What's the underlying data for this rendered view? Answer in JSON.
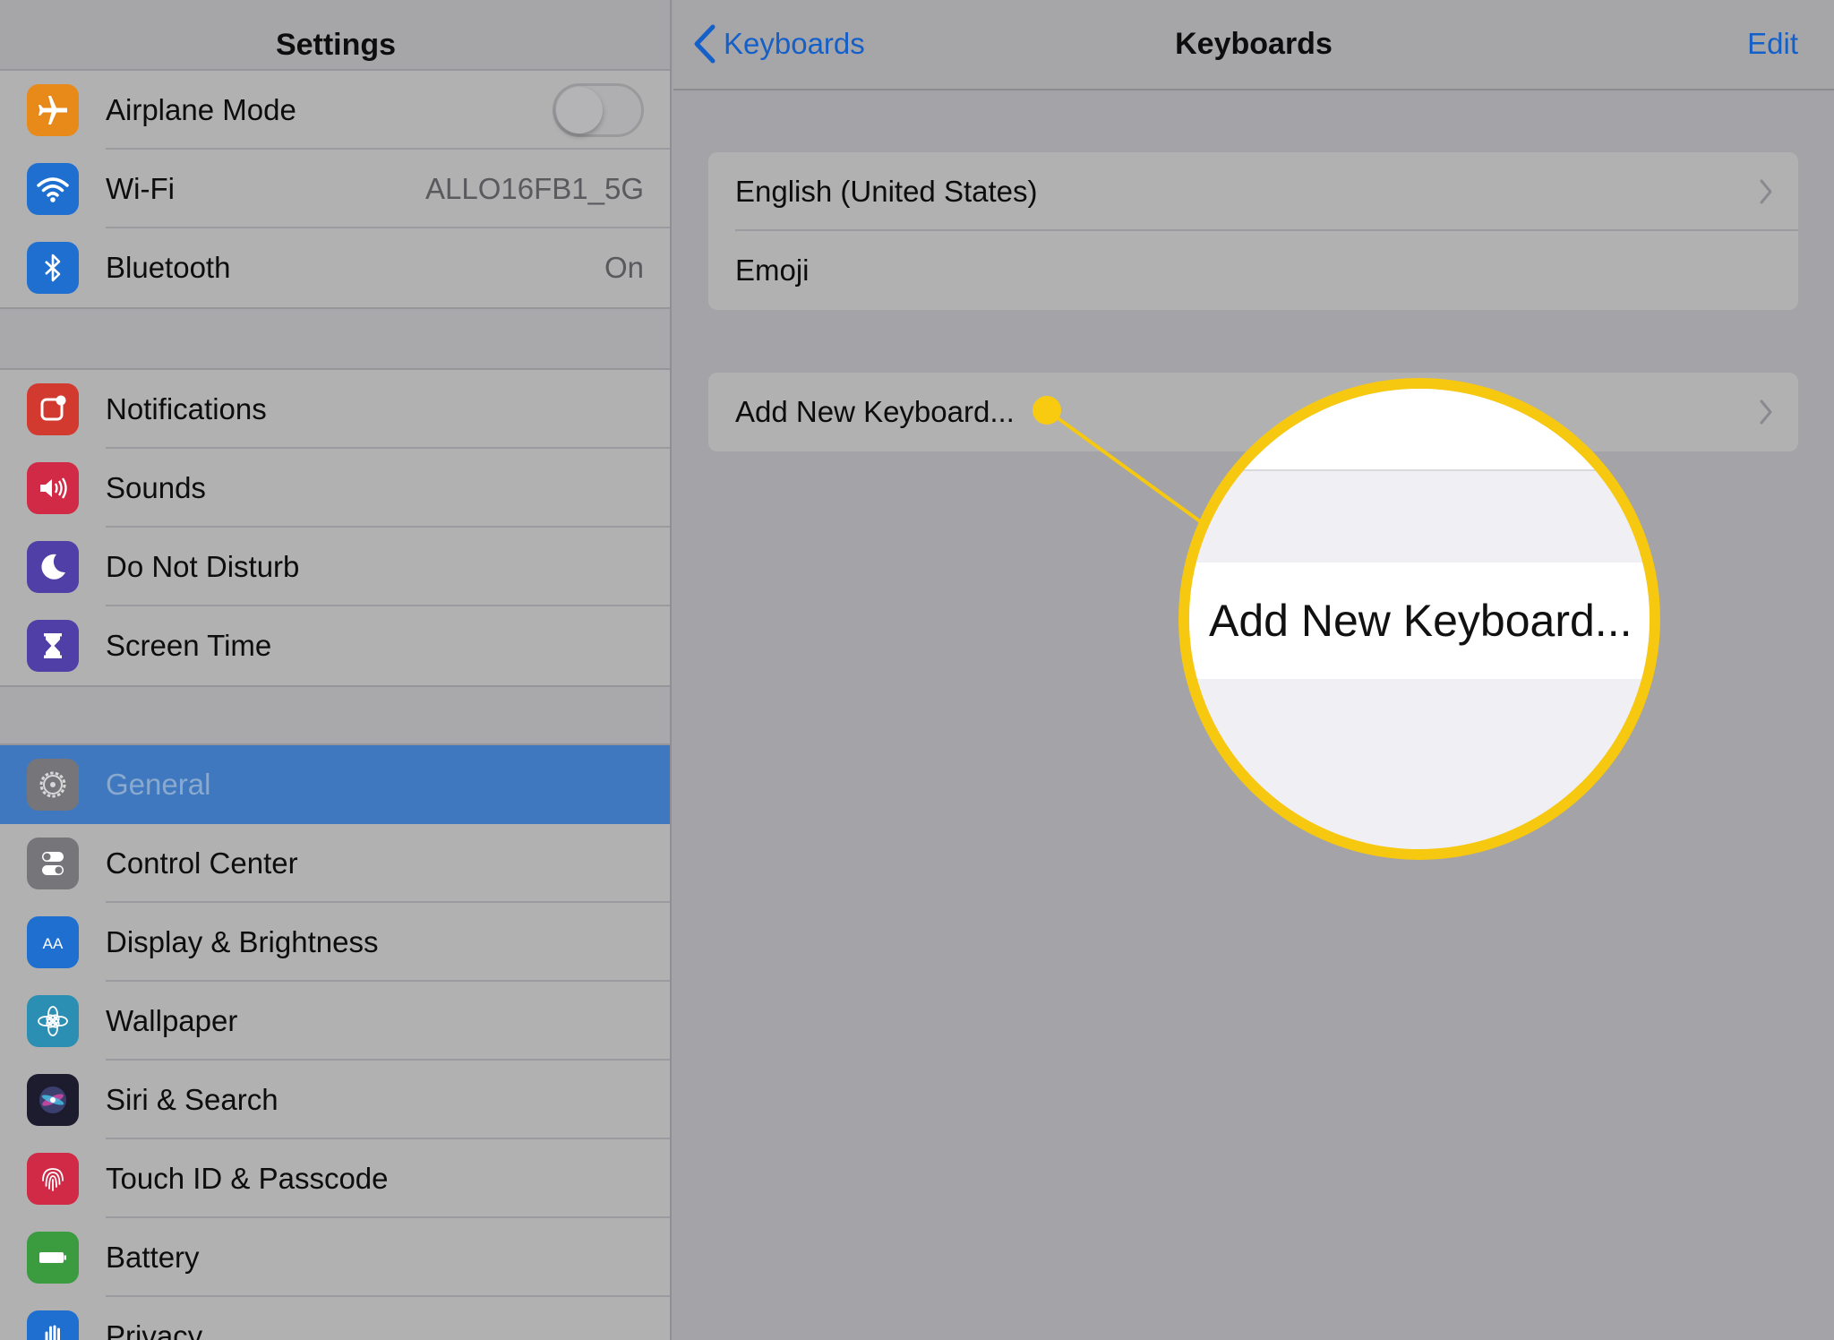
{
  "sidebar": {
    "title": "Settings",
    "groups": [
      {
        "items": [
          {
            "label": "Airplane Mode",
            "icon": "airplane-icon",
            "color": "#e88a1a",
            "control": "toggle",
            "toggle_on": false
          },
          {
            "label": "Wi-Fi",
            "icon": "wifi-icon",
            "color": "#1f6fd1",
            "value": "ALLO16FB1_5G"
          },
          {
            "label": "Bluetooth",
            "icon": "bluetooth-icon",
            "color": "#1f6fd1",
            "value": "On"
          }
        ]
      },
      {
        "items": [
          {
            "label": "Notifications",
            "icon": "notifications-icon",
            "color": "#d23a30"
          },
          {
            "label": "Sounds",
            "icon": "sounds-icon",
            "color": "#d02a47"
          },
          {
            "label": "Do Not Disturb",
            "icon": "moon-icon",
            "color": "#4f3fa6"
          },
          {
            "label": "Screen Time",
            "icon": "hourglass-icon",
            "color": "#4f3fa6"
          }
        ]
      },
      {
        "items": [
          {
            "label": "General",
            "icon": "gear-icon",
            "color": "#75757a",
            "selected": true
          },
          {
            "label": "Control Center",
            "icon": "switches-icon",
            "color": "#75757a"
          },
          {
            "label": "Display & Brightness",
            "icon": "display-icon",
            "color": "#1f6fd1"
          },
          {
            "label": "Wallpaper",
            "icon": "flower-icon",
            "color": "#2a8fb3"
          },
          {
            "label": "Siri & Search",
            "icon": "siri-icon",
            "color": "#1c1c2e"
          },
          {
            "label": "Touch ID & Passcode",
            "icon": "fingerprint-icon",
            "color": "#d02a47"
          },
          {
            "label": "Battery",
            "icon": "battery-icon",
            "color": "#3a9b3f"
          },
          {
            "label": "Privacy",
            "icon": "hand-icon",
            "color": "#1f6fd1"
          }
        ]
      }
    ]
  },
  "detail": {
    "back_label": "Keyboards",
    "title": "Keyboards",
    "edit_label": "Edit",
    "keyboards": [
      {
        "label": "English (United States)",
        "chevron": true
      },
      {
        "label": "Emoji",
        "chevron": false
      }
    ],
    "add_keyboard_label": "Add New Keyboard..."
  },
  "callout": {
    "label": "Add New Keyboard...",
    "color": "#f7c810"
  },
  "colors": {
    "accent": "#1560c8",
    "selected_row": "#3f78bf"
  }
}
